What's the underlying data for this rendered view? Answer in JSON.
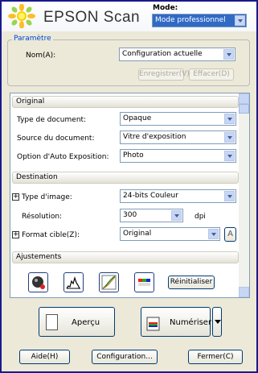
{
  "header": {
    "brand": "EPSON Scan",
    "mode_label": "Mode:",
    "mode_value": "Mode professionnel"
  },
  "parametre": {
    "legend": "Paramètre",
    "name_label": "Nom(A):",
    "name_value": "Configuration actuelle",
    "save_label": "Enregistrer(V)",
    "delete_label": "Effacer(D)"
  },
  "original": {
    "title": "Original",
    "doc_type_label": "Type de document:",
    "doc_type_value": "Opaque",
    "doc_source_label": "Source du document:",
    "doc_source_value": "Vitre d'exposition",
    "auto_exposure_label": "Option d'Auto Exposition:",
    "auto_exposure_value": "Photo"
  },
  "destination": {
    "title": "Destination",
    "image_type_label": "Type d'image:",
    "image_type_value": "24-bits Couleur",
    "resolution_label": "Résolution:",
    "resolution_value": "300",
    "resolution_unit": "dpi",
    "target_label": "Format cible(Z):",
    "target_value": "Original"
  },
  "adjustments": {
    "title": "Ajustements",
    "reset_label": "Réinitialiser"
  },
  "actions": {
    "preview_label": "Aperçu",
    "scan_label": "Numériser"
  },
  "footer": {
    "help_label": "Aide(H)",
    "config_label": "Configuration...",
    "close_label": "Fermer(C)"
  }
}
